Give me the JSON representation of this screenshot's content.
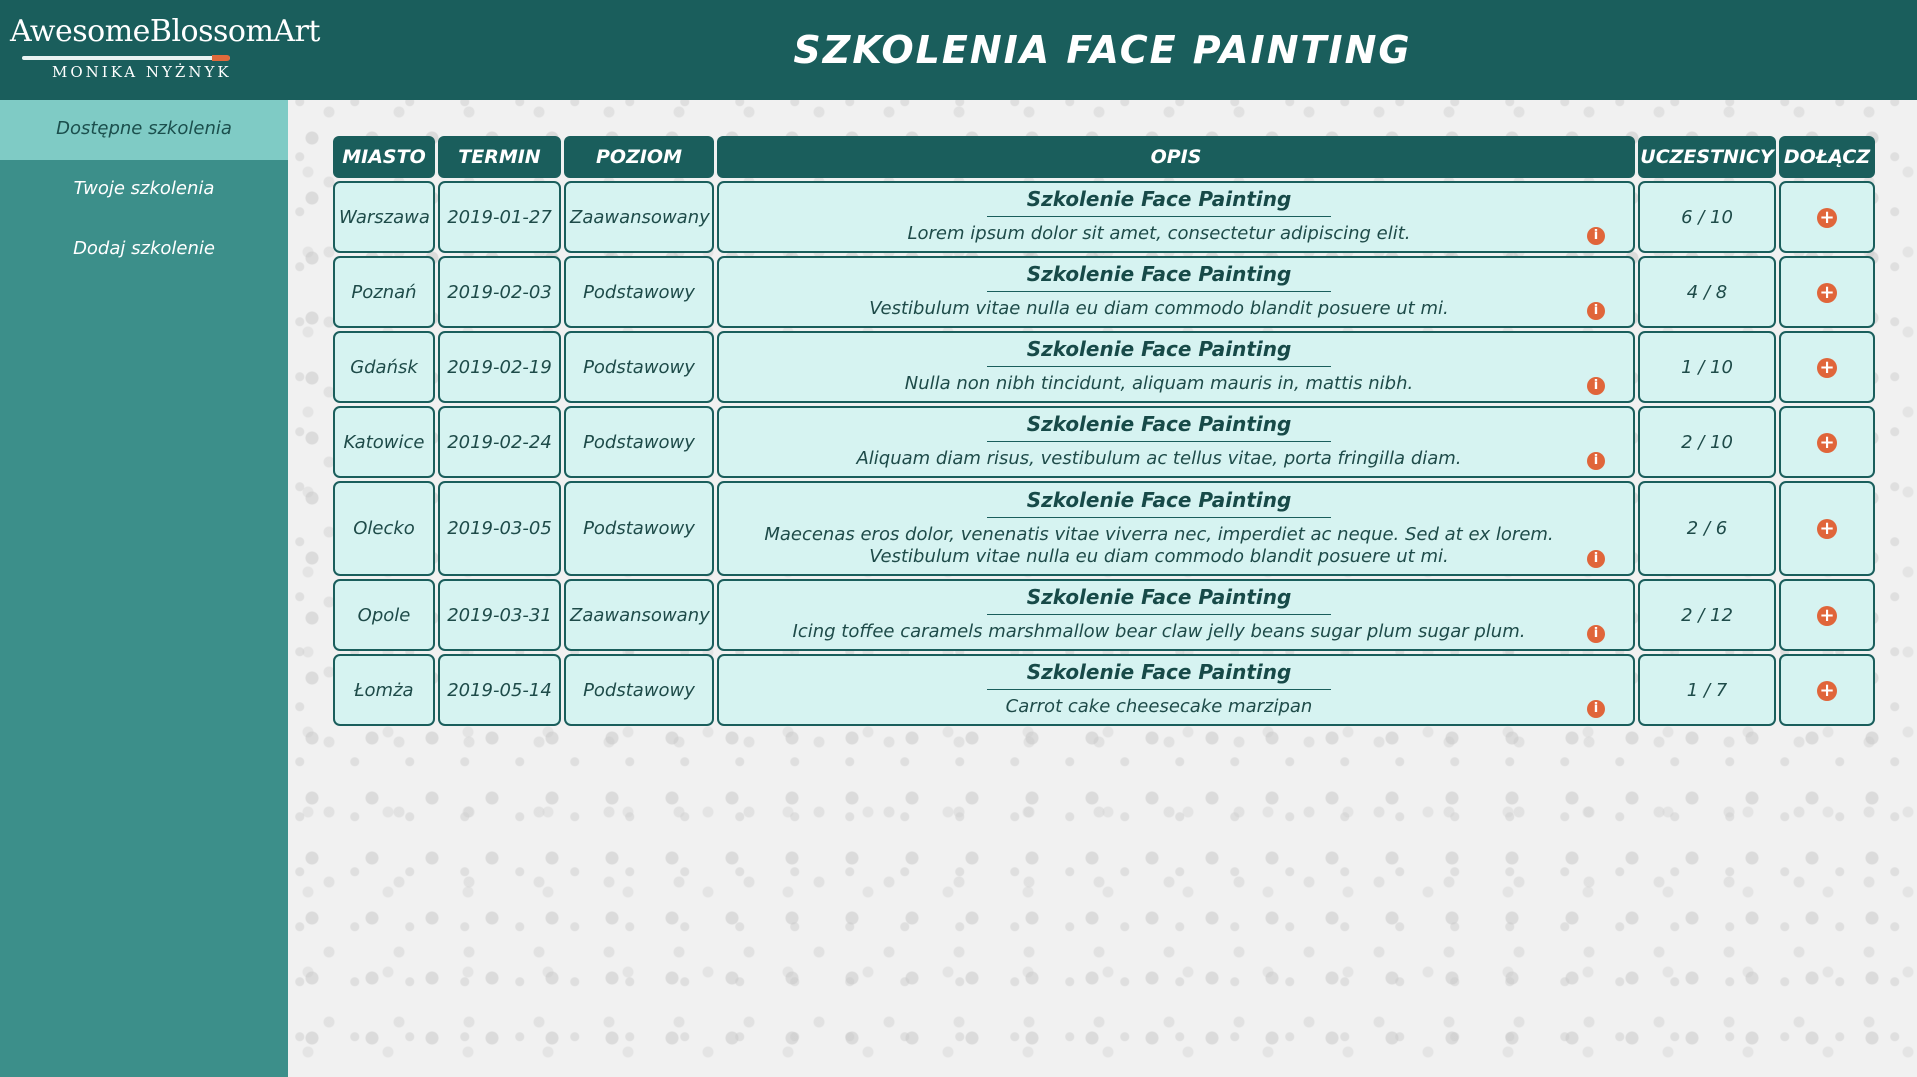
{
  "logo": {
    "main": "AwesomeBlossomArt",
    "sub": "MONIKA NYŻNYK"
  },
  "page_title": "SZKOLENIA FACE PAINTING",
  "sidebar": {
    "items": [
      {
        "label": "Dostępne szkolenia",
        "active": true
      },
      {
        "label": "Twoje szkolenia",
        "active": false
      },
      {
        "label": "Dodaj szkolenie",
        "active": false
      }
    ]
  },
  "table": {
    "headers": [
      "MIASTO",
      "TERMIN",
      "POZIOM",
      "OPIS",
      "UCZESTNICY",
      "DOŁĄCZ"
    ],
    "rows": [
      {
        "city": "Warszawa",
        "date": "2019-01-27",
        "level": "Zaawansowany",
        "title": "Szkolenie Face Painting",
        "desc": "Lorem ipsum dolor sit amet, consectetur adipiscing elit.",
        "participants": "6 / 10"
      },
      {
        "city": "Poznań",
        "date": "2019-02-03",
        "level": "Podstawowy",
        "title": "Szkolenie Face Painting",
        "desc": "Vestibulum vitae nulla eu diam commodo blandit posuere ut mi.",
        "participants": "4 / 8"
      },
      {
        "city": "Gdańsk",
        "date": "2019-02-19",
        "level": "Podstawowy",
        "title": "Szkolenie Face Painting",
        "desc": "Nulla non nibh tincidunt, aliquam mauris in, mattis nibh.",
        "participants": "1 / 10"
      },
      {
        "city": "Katowice",
        "date": "2019-02-24",
        "level": "Podstawowy",
        "title": "Szkolenie Face Painting",
        "desc": "Aliquam diam risus, vestibulum ac tellus vitae, porta fringilla diam.",
        "participants": "2 / 10"
      },
      {
        "city": "Olecko",
        "date": "2019-03-05",
        "level": "Podstawowy",
        "title": "Szkolenie Face Painting",
        "desc": "Maecenas eros dolor, venenatis vitae viverra nec, imperdiet ac neque. Sed at ex lorem. Vestibulum vitae nulla eu diam commodo blandit posuere ut mi.",
        "participants": "2 / 6"
      },
      {
        "city": "Opole",
        "date": "2019-03-31",
        "level": "Zaawansowany",
        "title": "Szkolenie Face Painting",
        "desc": "Icing toffee caramels marshmallow bear claw jelly beans sugar plum sugar plum.",
        "participants": "2 / 12"
      },
      {
        "city": "Łomża",
        "date": "2019-05-14",
        "level": "Podstawowy",
        "title": "Szkolenie Face Painting",
        "desc": "Carrot cake cheesecake marzipan",
        "participants": "1 / 7"
      }
    ]
  },
  "icons": {
    "info": "info-icon",
    "join": "plus-circle-icon"
  },
  "colors": {
    "header_bg": "#1a5e5c",
    "sidebar_bg": "#3c8f8a",
    "sidebar_active": "#7fcbc5",
    "cell_bg": "#d6f3f1",
    "accent": "#e0653a"
  }
}
